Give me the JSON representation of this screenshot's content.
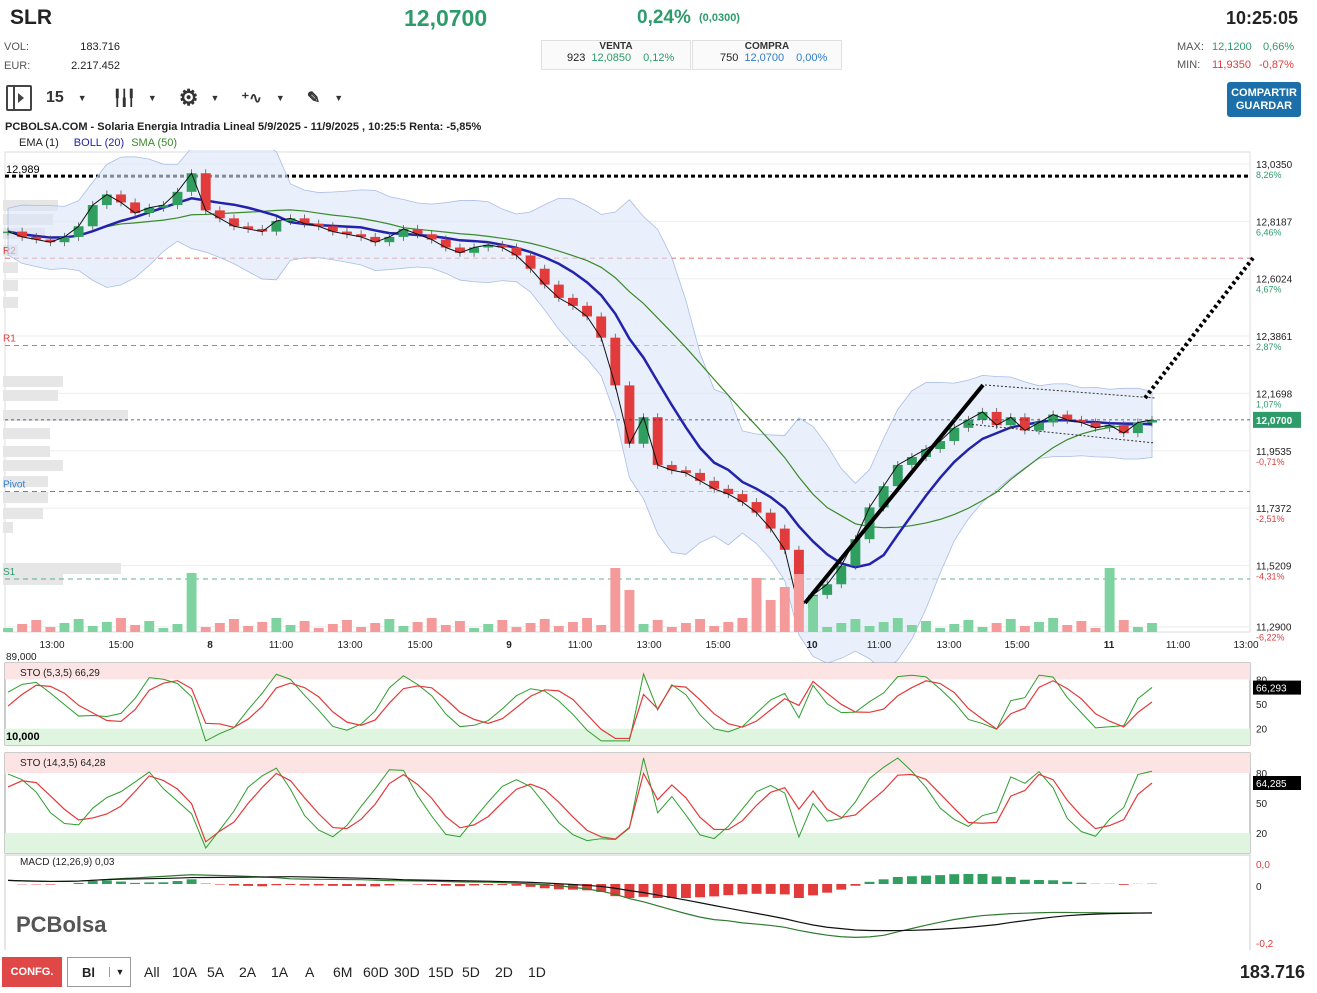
{
  "header": {
    "ticker": "SLR",
    "price": "12,0700",
    "change_pct": "0,24%",
    "change_abs": "(0,0300)",
    "time": "10:25:05",
    "vol_label": "VOL:",
    "vol_value": "183.716",
    "eur_label": "EUR:",
    "eur_value": "2.217.452",
    "venta_label": "VENTA",
    "venta_qty": "923",
    "venta_price": "12,0850",
    "venta_pct": "0,12%",
    "compra_label": "COMPRA",
    "compra_qty": "750",
    "compra_price": "12,0700",
    "compra_pct": "0,00%",
    "max_label": "MAX:",
    "max_value": "12,1200",
    "max_pct": "0,66%",
    "min_label": "MIN:",
    "min_value": "11,9350",
    "min_pct": "-0,87%"
  },
  "toolbar": {
    "interval": "15",
    "button_line1": "COMPARTIR",
    "button_line2": "GUARDAR"
  },
  "chart_title": "PCBOLSA.COM - Solaria Energia Intradia Lineal 5/9/2025 - 11/9/2025 , 10:25:5 Renta: -5,85%",
  "legend": {
    "ema": "EMA (1)",
    "boll": "BOLL (20)",
    "sma": "SMA (50)"
  },
  "colors": {
    "up": "#2f9e5f",
    "down": "#e23b3b",
    "boll": "#2222aa",
    "sma": "#3a8a2a",
    "band": "#dbe6f8"
  },
  "chart_data": [
    {
      "type": "candlestick",
      "title": "PCBOLSA.COM - Solaria Energia Intradia Lineal 5/9/2025 - 11/9/2025 , 10:25:5 Renta: -5,85%",
      "x_ticks": [
        "13:00",
        "15:00",
        "8",
        "11:00",
        "13:00",
        "15:00",
        "9",
        "11:00",
        "13:00",
        "15:00",
        "10",
        "11:00",
        "13:00",
        "15:00",
        "11",
        "11:00",
        "13:00"
      ],
      "y_ticks": [
        {
          "value": "13,0350",
          "pct": "8,26%"
        },
        {
          "value": "12,8187",
          "pct": "6,46%"
        },
        {
          "value": "12,6024",
          "pct": "4,67%"
        },
        {
          "value": "12,3861",
          "pct": "2,87%"
        },
        {
          "value": "12,1698",
          "pct": "1,07%"
        },
        {
          "value": "11,9535",
          "pct": "-0,71%"
        },
        {
          "value": "11,7372",
          "pct": "-2,51%"
        },
        {
          "value": "11,5209",
          "pct": "-4,31%"
        },
        {
          "value": "11,2900",
          "pct": "-6,22%"
        }
      ],
      "last_price": "12,0700",
      "levels": [
        {
          "name": "",
          "value": 12.989,
          "label": "12,989"
        },
        {
          "name": "R2",
          "value": 12.68,
          "label": "R2"
        },
        {
          "name": "R1",
          "value": 12.35,
          "label": "R1"
        },
        {
          "name": "Pivot",
          "value": 11.8,
          "label": "Pivot"
        },
        {
          "name": "S1",
          "value": 11.47,
          "label": "S1"
        }
      ],
      "close_path": [
        12.78,
        12.76,
        12.75,
        12.74,
        12.76,
        12.8,
        12.88,
        12.92,
        12.89,
        12.85,
        12.87,
        12.88,
        12.93,
        13.0,
        12.86,
        12.83,
        12.8,
        12.79,
        12.78,
        12.82,
        12.83,
        12.81,
        12.8,
        12.78,
        12.77,
        12.76,
        12.74,
        12.76,
        12.79,
        12.77,
        12.75,
        12.72,
        12.7,
        12.72,
        12.73,
        12.72,
        12.69,
        12.64,
        12.58,
        12.53,
        12.5,
        12.46,
        12.38,
        12.2,
        11.98,
        12.08,
        11.9,
        11.88,
        11.87,
        11.84,
        11.81,
        11.79,
        11.76,
        11.72,
        11.66,
        11.58,
        11.36,
        11.41,
        11.45,
        11.52,
        11.62,
        11.74,
        11.82,
        11.9,
        11.93,
        11.96,
        11.99,
        12.04,
        12.07,
        12.1,
        12.05,
        12.08,
        12.03,
        12.06,
        12.09,
        12.07,
        12.06,
        12.04,
        12.05,
        12.02,
        12.06,
        12.07
      ],
      "volume_note": "volume bars per candle, peak near 9 session 13:00 and 10 session open"
    },
    {
      "type": "line",
      "title": "89,000",
      "subtitle": "STO (5,3,5) 66,29",
      "y_ticks": [
        "80",
        "50",
        "20"
      ],
      "last": "66,293",
      "min_label": "10,000"
    },
    {
      "type": "line",
      "title": "STO (14,3,5) 64,28",
      "y_ticks": [
        "80",
        "50",
        "20"
      ],
      "last": "64,285"
    },
    {
      "type": "bar",
      "title": "MACD (12,26,9) 0,03",
      "y_ticks": [
        "0,0",
        "0",
        "-0,2"
      ]
    }
  ],
  "timeframes": [
    "All",
    "10A",
    "5A",
    "2A",
    "1A",
    "A",
    "6M",
    "60D",
    "30D",
    "15D",
    "5D",
    "2D",
    "1D"
  ],
  "bottom": {
    "confg": "CONFG.",
    "mode": "Bl",
    "volume": "183.716"
  },
  "logo": "PCBolsa"
}
